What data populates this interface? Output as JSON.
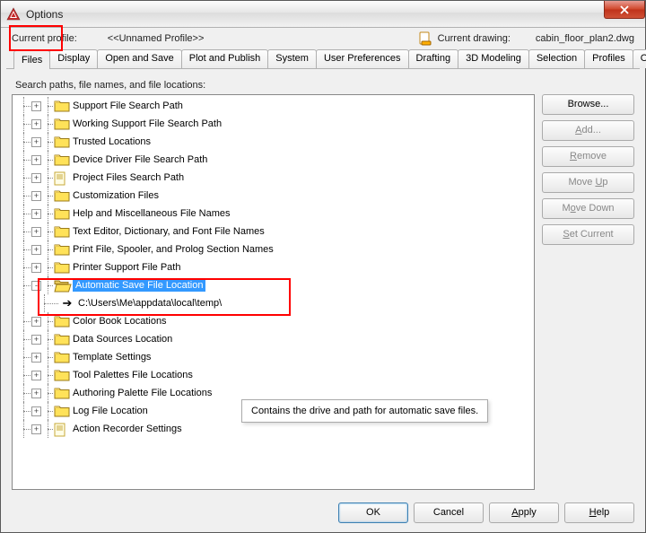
{
  "title": "Options",
  "profile_row": {
    "label": "Current profile:",
    "value": "<<Unnamed Profile>>",
    "drawing_label": "Current drawing:",
    "drawing_value": "cabin_floor_plan2.dwg"
  },
  "tabs": [
    "Files",
    "Display",
    "Open and Save",
    "Plot and Publish",
    "System",
    "User Preferences",
    "Drafting",
    "3D Modeling",
    "Selection",
    "Profiles",
    "Online"
  ],
  "section_label": "Search paths, file names, and file locations:",
  "tree": [
    {
      "type": "folder",
      "exp": "+",
      "label": "Support File Search Path"
    },
    {
      "type": "folder",
      "exp": "+",
      "label": "Working Support File Search Path"
    },
    {
      "type": "folder",
      "exp": "+",
      "label": "Trusted Locations"
    },
    {
      "type": "folder",
      "exp": "+",
      "label": "Device Driver File Search Path"
    },
    {
      "type": "file",
      "exp": "+",
      "label": "Project Files Search Path"
    },
    {
      "type": "folder",
      "exp": "+",
      "label": "Customization Files"
    },
    {
      "type": "folder",
      "exp": "+",
      "label": "Help and Miscellaneous File Names"
    },
    {
      "type": "folder",
      "exp": "+",
      "label": "Text Editor, Dictionary, and Font File Names"
    },
    {
      "type": "folder",
      "exp": "+",
      "label": "Print File, Spooler, and Prolog Section Names"
    },
    {
      "type": "folder",
      "exp": "+",
      "label": "Printer Support File Path"
    },
    {
      "type": "folder-open",
      "exp": "-",
      "label": "Automatic Save File Location",
      "selected": true
    },
    {
      "type": "path",
      "label": "C:\\Users\\Me\\appdata\\local\\temp\\",
      "child": true
    },
    {
      "type": "folder",
      "exp": "+",
      "label": "Color Book Locations"
    },
    {
      "type": "folder",
      "exp": "+",
      "label": "Data Sources Location"
    },
    {
      "type": "folder",
      "exp": "+",
      "label": "Template Settings"
    },
    {
      "type": "folder",
      "exp": "+",
      "label": "Tool Palettes File Locations"
    },
    {
      "type": "folder",
      "exp": "+",
      "label": "Authoring Palette File Locations"
    },
    {
      "type": "folder",
      "exp": "+",
      "label": "Log File Location"
    },
    {
      "type": "file",
      "exp": "+",
      "label": "Action Recorder Settings"
    }
  ],
  "side_buttons": {
    "browse": "Browse...",
    "add": "Add...",
    "remove": "Remove",
    "moveup": "Move Up",
    "movedown": "Move Down",
    "setcurrent": "Set Current"
  },
  "tooltip": "Contains the drive and path for automatic save files.",
  "footer": {
    "ok": "OK",
    "cancel": "Cancel",
    "apply": "Apply",
    "help": "Help"
  }
}
